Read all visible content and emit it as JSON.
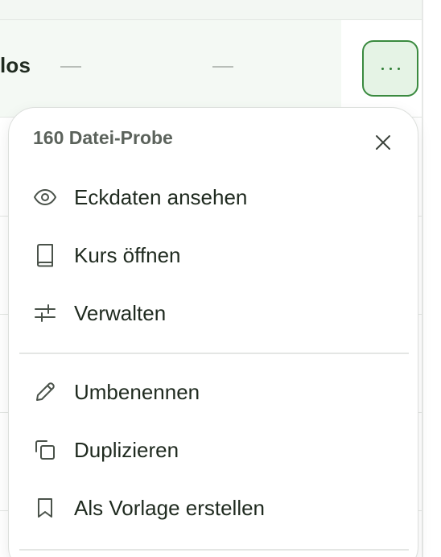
{
  "table": {
    "row_name_fragment": "los",
    "row_col2": "—",
    "row_col3": "—",
    "more_button_label": "···"
  },
  "menu": {
    "title": "160 Datei-Probe",
    "close_label": "×",
    "items": [
      {
        "label": "Eckdaten ansehen",
        "icon": "eye-icon"
      },
      {
        "label": "Kurs öffnen",
        "icon": "book-icon"
      },
      {
        "label": "Verwalten",
        "icon": "sliders-icon"
      },
      {
        "label": "Umbenennen",
        "icon": "pencil-icon"
      },
      {
        "label": "Duplizieren",
        "icon": "copy-icon"
      },
      {
        "label": "Als Vorlage erstellen",
        "icon": "bookmark-icon"
      }
    ]
  },
  "colors": {
    "accent": "#3a8a3f",
    "accent_bg": "#e5f3e5",
    "text": "#1f2a1f",
    "muted": "#5b625b"
  }
}
